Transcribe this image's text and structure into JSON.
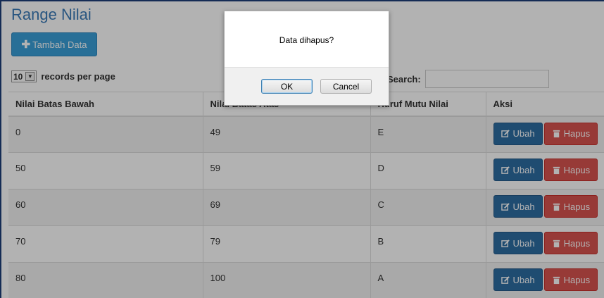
{
  "page": {
    "title": "Range Nilai",
    "add_button": "Tambah Data",
    "perpage_value": "10",
    "perpage_label": "records per page",
    "search_label": "Search:"
  },
  "table": {
    "headers": [
      "Nilai Batas Bawah",
      "Nilai Batas Atas",
      "Huruf Mutu Nilai",
      "Aksi"
    ],
    "rows": [
      [
        "0",
        "49",
        "E"
      ],
      [
        "50",
        "59",
        "D"
      ],
      [
        "60",
        "69",
        "C"
      ],
      [
        "70",
        "79",
        "B"
      ],
      [
        "80",
        "100",
        "A"
      ]
    ],
    "edit_label": "Ubah",
    "delete_label": "Hapus"
  },
  "dialog": {
    "message": "Data dihapus?",
    "ok_label": "OK",
    "cancel_label": "Cancel"
  },
  "colors": {
    "title": "#3a7ab8",
    "add_button": "#3a9fd8",
    "edit_button": "#2d6da3",
    "delete_button": "#d9534f"
  },
  "icons": {
    "add": "plus-icon",
    "edit": "edit-icon",
    "delete": "trash-icon",
    "dropdown": "chevron-down-icon"
  }
}
